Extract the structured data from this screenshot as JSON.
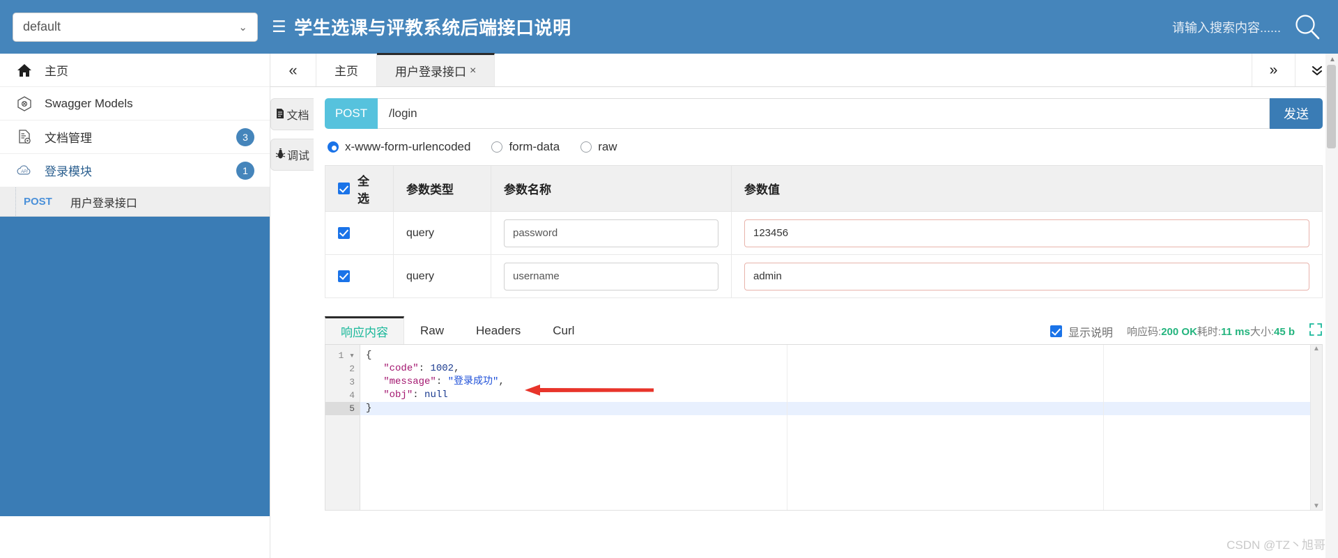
{
  "header": {
    "project_select_value": "default",
    "select_chevron": "chevron-down-icon",
    "logo_glyph": "☰",
    "title": "学生选课与评教系统后端接口说明",
    "search_placeholder": "请输入搜索内容......",
    "search_icon": "search-icon",
    "bg_color": "#4585bb"
  },
  "sidebar": {
    "items": [
      {
        "label": "主页",
        "icon": "home-icon",
        "badge": ""
      },
      {
        "label": "Swagger Models",
        "icon": "cube-icon",
        "badge": ""
      },
      {
        "label": "文档管理",
        "icon": "doc-gear-icon",
        "badge": "3"
      },
      {
        "label": "登录模块",
        "icon": "api-cloud-icon",
        "badge": "1"
      }
    ],
    "api_entry": {
      "method": "POST",
      "label": "用户登录接口"
    }
  },
  "tabs": {
    "collapse_icon": "«",
    "items": [
      {
        "label": "主页",
        "closable": false,
        "active": false
      },
      {
        "label": "用户登录接口",
        "closable": true,
        "close_glyph": "×",
        "active": true
      }
    ],
    "right_icons": [
      {
        "name": "chevron-double-right-icon",
        "glyph": "»"
      },
      {
        "name": "chevron-double-down-icon",
        "glyph": "⌄"
      }
    ]
  },
  "vtabs": [
    {
      "label": "文档",
      "icon": "document-icon",
      "glyph": "🗎",
      "active": false
    },
    {
      "label": "调试",
      "icon": "bug-icon",
      "glyph": "🐞",
      "active": true
    }
  ],
  "request": {
    "method": "POST",
    "url": "/login",
    "send_label": "发送",
    "body_types": [
      {
        "label": "x-www-form-urlencoded",
        "selected": true
      },
      {
        "label": "form-data",
        "selected": false
      },
      {
        "label": "raw",
        "selected": false
      }
    ]
  },
  "params_table": {
    "headers": [
      "全选",
      "参数类型",
      "参数名称",
      "参数值"
    ],
    "select_all_checked": true,
    "rows": [
      {
        "checked": true,
        "type": "query",
        "name": "password",
        "value": "123456"
      },
      {
        "checked": true,
        "type": "query",
        "name": "username",
        "value": "admin"
      }
    ]
  },
  "response": {
    "tabs": [
      {
        "label": "响应内容",
        "active": true
      },
      {
        "label": "Raw",
        "active": false
      },
      {
        "label": "Headers",
        "active": false
      },
      {
        "label": "Curl",
        "active": false
      }
    ],
    "show_desc_label": "显示说明",
    "show_desc_checked": true,
    "status_label": "响应码:",
    "status_value": "200 OK",
    "time_label": "耗时:",
    "time_value": "11 ms",
    "size_label": "大小:",
    "size_value": "45 b",
    "expand_icon": "expand-fullscreen-icon",
    "code_lines": [
      {
        "no": "1",
        "foldable": true,
        "text": "{"
      },
      {
        "no": "2",
        "foldable": false,
        "text": "  \"code\": 1002,"
      },
      {
        "no": "3",
        "foldable": false,
        "text": "  \"message\": \"登录成功\","
      },
      {
        "no": "4",
        "foldable": false,
        "text": "  \"obj\": null"
      },
      {
        "no": "5",
        "foldable": false,
        "text": "}"
      }
    ],
    "json": {
      "code": 1002,
      "message": "登录成功",
      "obj": null
    }
  },
  "watermark": "CSDN @TZ丶旭哥"
}
